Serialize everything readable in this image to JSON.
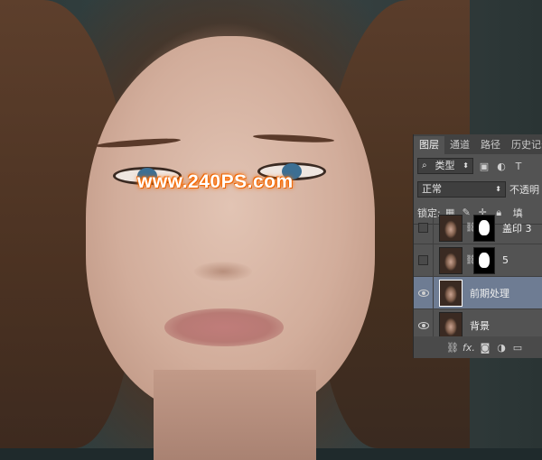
{
  "watermark": "www.240PS.com",
  "panel": {
    "tabs": [
      "图层",
      "通道",
      "路径",
      "历史记录"
    ],
    "filter_select": "类型",
    "blend_mode": "正常",
    "opacity_label": "不透明",
    "lock_label": "锁定:",
    "fill_label": "填",
    "layers": [
      {
        "name": "盖印 3",
        "visible": false,
        "has_mask": true
      },
      {
        "name": "5",
        "visible": false,
        "has_mask": true
      },
      {
        "name": "前期处理",
        "visible": true,
        "has_mask": false,
        "active": true
      },
      {
        "name": "背景",
        "visible": true,
        "has_mask": false
      }
    ],
    "bottom_icons": [
      "link-icon",
      "fx-icon",
      "mask-icon",
      "adjustment-icon",
      "group-icon"
    ],
    "fx_label": "fx."
  },
  "colors": {
    "panel_bg": "#535353",
    "tab_bar": "#424242",
    "active_layer": "#6e7c93",
    "watermark_glow": "#ff6a00"
  }
}
